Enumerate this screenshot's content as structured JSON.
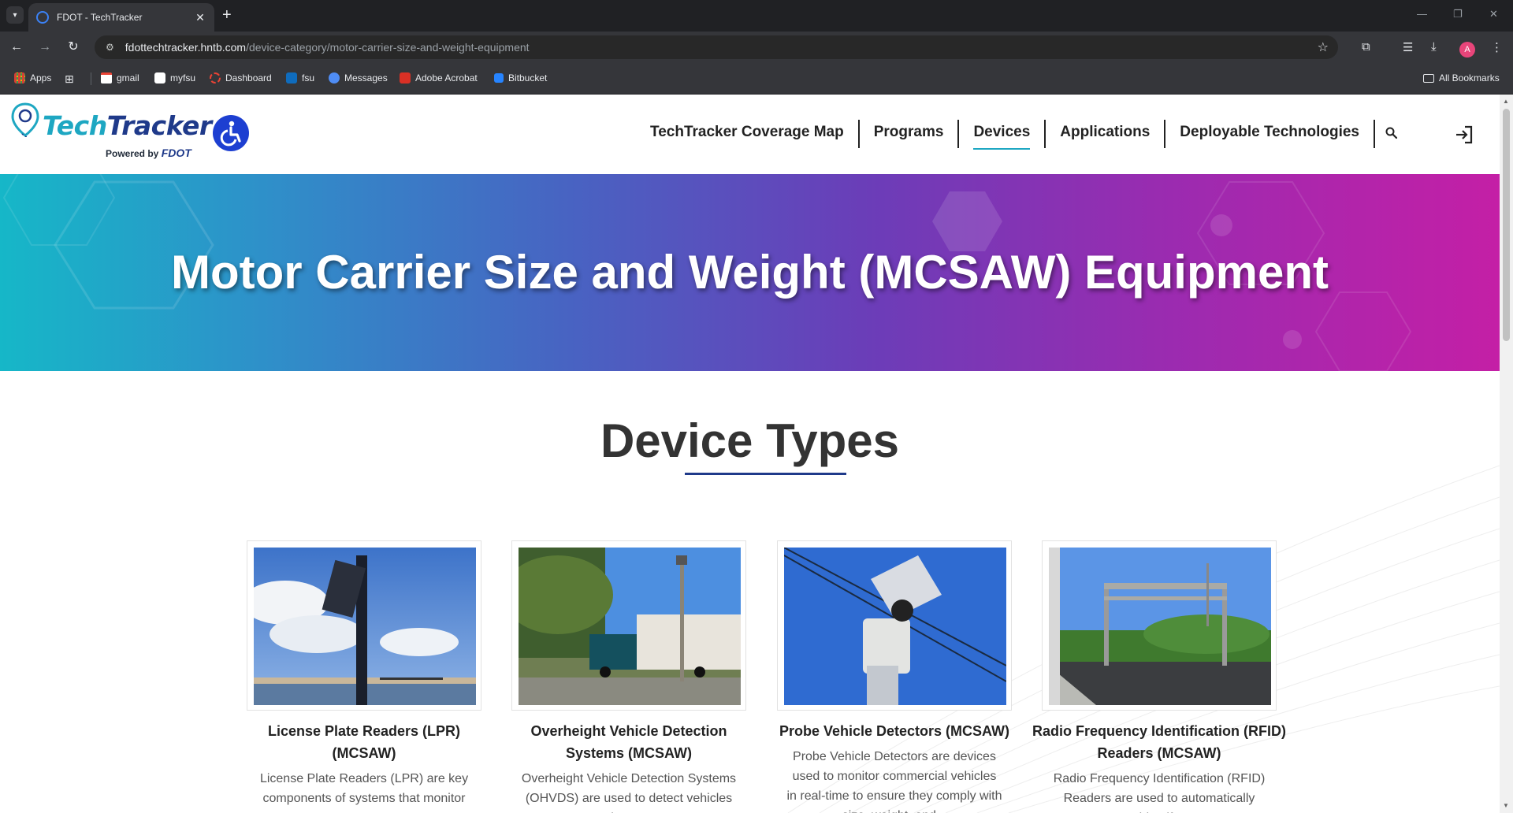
{
  "browser": {
    "tab_title": "FDOT - TechTracker",
    "url_host": "fdottechtracker.hntb.com",
    "url_path": "/device-category/motor-carrier-size-and-weight-equipment",
    "profile_initial": "A",
    "bookmarks": [
      "Apps",
      "gmail",
      "myfsu",
      "Dashboard",
      "fsu",
      "Messages",
      "Adobe Acrobat",
      "Bitbucket"
    ],
    "all_bookmarks_label": "All Bookmarks"
  },
  "header": {
    "logo_tech": "Tech",
    "logo_tracker": "Tracker",
    "logo_powered_by": "Powered by ",
    "logo_fdot": "FDOT",
    "nav": [
      "TechTracker Coverage Map",
      "Programs",
      "Devices",
      "Applications",
      "Deployable Technologies"
    ],
    "active_nav": "Devices"
  },
  "hero": {
    "title": "Motor Carrier Size and Weight (MCSAW) Equipment"
  },
  "section": {
    "title": "Device Types"
  },
  "cards": [
    {
      "title": "License Plate Readers (LPR) (MCSAW)",
      "description": "License Plate Readers (LPR) are key components of systems that monitor"
    },
    {
      "title": "Overheight Vehicle Detection Systems (MCSAW)",
      "description": "Overheight Vehicle Detection Systems (OHVDS) are used to detect vehicles that are"
    },
    {
      "title": "Probe Vehicle Detectors (MCSAW)",
      "description": "Probe Vehicle Detectors are devices used to monitor commercial vehicles in real-time to ensure they comply with size, weight, and..."
    },
    {
      "title": "Radio Frequency Identification (RFID) Readers (MCSAW)",
      "description": "Radio Frequency Identification (RFID) Readers are used to automatically identify"
    }
  ],
  "colors": {
    "brand_teal": "#1ea7c2",
    "brand_navy": "#1f3a8a",
    "hero_start": "#16b7c8",
    "hero_end": "#c41fa6",
    "accessibility_blue": "#1d3fd1"
  }
}
